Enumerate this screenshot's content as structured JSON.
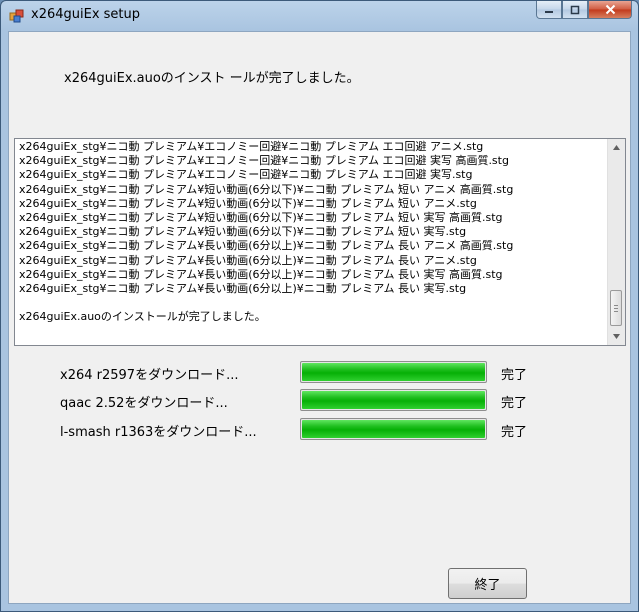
{
  "window": {
    "title": "x264guiEx setup",
    "minimize_icon": "minimize-icon",
    "maximize_icon": "maximize-icon",
    "close_icon": "close-icon"
  },
  "status_message": "x264guiEx.auoのインスト ールが完了しました。",
  "log": {
    "lines": [
      "x264guiEx_stg¥ニコ動 プレミアム¥エコノミー回避¥ニコ動 プレミアム エコ回避 アニメ.stg",
      "x264guiEx_stg¥ニコ動 プレミアム¥エコノミー回避¥ニコ動 プレミアム エコ回避 実写 高画質.stg",
      "x264guiEx_stg¥ニコ動 プレミアム¥エコノミー回避¥ニコ動 プレミアム エコ回避 実写.stg",
      "x264guiEx_stg¥ニコ動 プレミアム¥短い動画(6分以下)¥ニコ動 プレミアム 短い アニメ 高画質.stg",
      "x264guiEx_stg¥ニコ動 プレミアム¥短い動画(6分以下)¥ニコ動 プレミアム 短い アニメ.stg",
      "x264guiEx_stg¥ニコ動 プレミアム¥短い動画(6分以下)¥ニコ動 プレミアム 短い 実写 高画質.stg",
      "x264guiEx_stg¥ニコ動 プレミアム¥短い動画(6分以下)¥ニコ動 プレミアム 短い 実写.stg",
      "x264guiEx_stg¥ニコ動 プレミアム¥長い動画(6分以上)¥ニコ動 プレミアム 長い アニメ 高画質.stg",
      "x264guiEx_stg¥ニコ動 プレミアム¥長い動画(6分以上)¥ニコ動 プレミアム 長い アニメ.stg",
      "x264guiEx_stg¥ニコ動 プレミアム¥長い動画(6分以上)¥ニコ動 プレミアム 長い 実写 高画質.stg",
      "x264guiEx_stg¥ニコ動 プレミアム¥長い動画(6分以上)¥ニコ動 プレミアム 長い 実写.stg"
    ],
    "final_line": "x264guiEx.auoのインストールが完了しました。"
  },
  "downloads": [
    {
      "label": "x264 r2597をダウンロード...",
      "progress_percent": 100,
      "status": "完了"
    },
    {
      "label": "qaac 2.52をダウンロード...",
      "progress_percent": 100,
      "status": "完了"
    },
    {
      "label": "l-smash r1363をダウンロード...",
      "progress_percent": 100,
      "status": "完了"
    }
  ],
  "finish_button": {
    "label": "終了"
  },
  "colors": {
    "progress_fill": "#06b006",
    "close_button": "#c2391b",
    "titlebar": "#bcd3ea"
  }
}
